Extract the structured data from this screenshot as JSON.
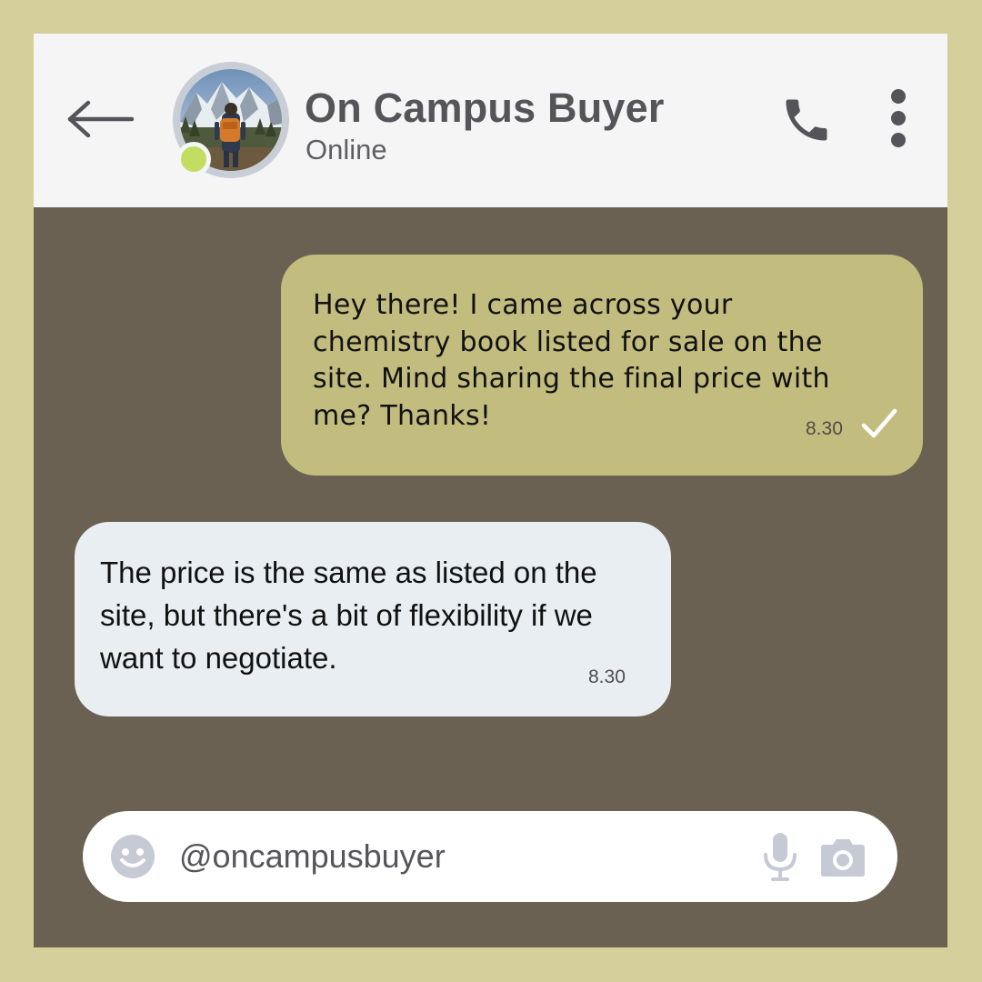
{
  "colors": {
    "frame": "#d5d09b",
    "chat_background": "#6a6152",
    "header_background": "#f5f5f6",
    "outgoing_bubble": "#c2bd7f",
    "incoming_bubble": "#e8eef1",
    "online_indicator": "#c3dd62",
    "input_icons": "#c5cad4"
  },
  "header": {
    "back_icon": "arrow-left-icon",
    "contact_name": "On Campus Buyer",
    "status": "Online",
    "call_icon": "phone-icon",
    "menu_icon": "more-vertical-icon"
  },
  "messages": [
    {
      "direction": "outgoing",
      "text": "Hey there! I came across your chemistry book listed for sale on the site. Mind sharing the final price with me? Thanks!",
      "time": "8.30",
      "status_icon": "check-icon"
    },
    {
      "direction": "incoming",
      "text": "The price is the same as listed on the site, but there's a bit of flexibility if we want to negotiate.",
      "time": "8.30"
    }
  ],
  "composer": {
    "emoji_icon": "emoji-icon",
    "placeholder": "@oncampusbuyer",
    "mic_icon": "microphone-icon",
    "camera_icon": "camera-icon"
  }
}
